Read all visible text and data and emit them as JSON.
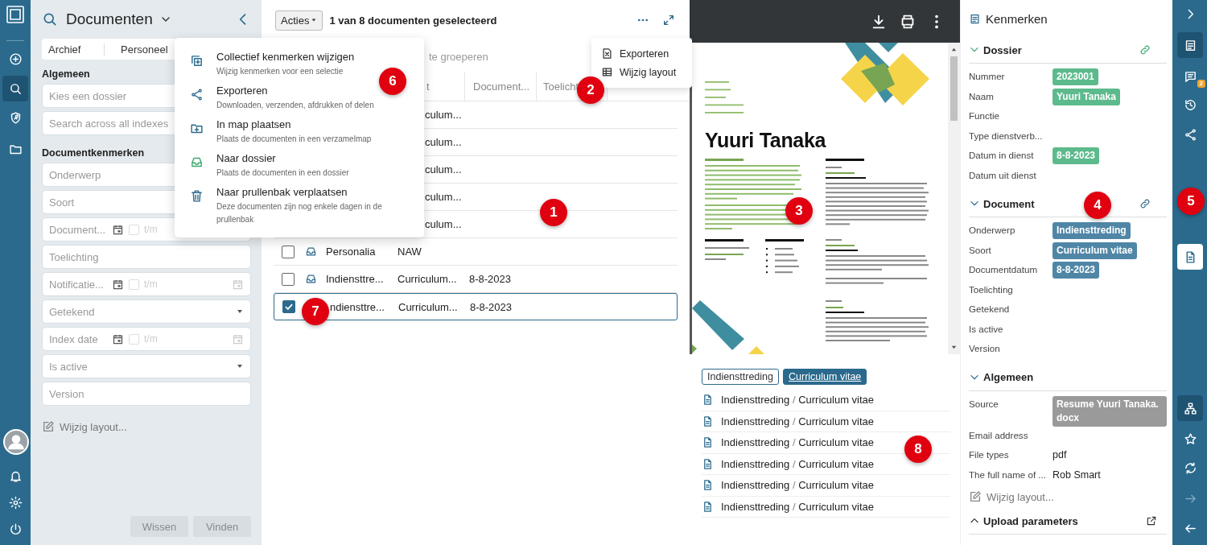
{
  "left_rail": {
    "top": [
      {
        "kind": "add",
        "selected": false
      },
      {
        "kind": "search",
        "selected": true
      },
      {
        "kind": "shield",
        "selected": false
      },
      {
        "kind": "folder",
        "selected": false
      }
    ],
    "bottom": [
      {
        "kind": "bell",
        "selected": false
      },
      {
        "kind": "gear",
        "selected": false
      },
      {
        "kind": "power",
        "selected": false
      }
    ]
  },
  "filter_panel": {
    "title": "Documenten",
    "tabs": [
      "Archief",
      "Personeel"
    ],
    "sections": [
      {
        "heading": "Algemeen",
        "fields": [
          {
            "kind": "text",
            "placeholder": "Kies een dossier"
          },
          {
            "kind": "text",
            "placeholder": "Search across all indexes"
          }
        ]
      },
      {
        "heading": "Documentkenmerken",
        "fields": [
          {
            "kind": "text",
            "placeholder": "Onderwerp"
          },
          {
            "kind": "text",
            "placeholder": "Soort"
          },
          {
            "kind": "daterange",
            "placeholder": "Document...",
            "to": "t/m",
            "checked": false
          },
          {
            "kind": "text",
            "placeholder": "Toelichting"
          },
          {
            "kind": "daterange",
            "placeholder": "Notificatie...",
            "to": "t/m",
            "checked": false,
            "end_calendar": true
          },
          {
            "kind": "select",
            "placeholder": "Getekend"
          },
          {
            "kind": "daterange",
            "placeholder": "Index date",
            "to": "t/m",
            "checked": false,
            "end_calendar": true
          },
          {
            "kind": "select",
            "placeholder": "Is active"
          },
          {
            "kind": "text",
            "placeholder": "Version"
          }
        ]
      }
    ],
    "edit_layout": "Wijzig layout...",
    "buttons": [
      {
        "label": "Wissen",
        "disabled": true
      },
      {
        "label": "Vinden",
        "disabled": true
      }
    ]
  },
  "toolbar": {
    "actions_button": "Acties",
    "selection_text": "1 van 8 documenten geselecteerd"
  },
  "group_hint": "te groeperen",
  "table": {
    "columns": [
      "t",
      "Document...",
      "Toelicht"
    ],
    "covered_rows": [
      {
        "type": "culum..."
      },
      {
        "type": "culum..."
      },
      {
        "type": "culum..."
      },
      {
        "type": "culum..."
      },
      {
        "type": "culum..."
      }
    ],
    "rows": [
      {
        "checked": false,
        "selected": false,
        "kind": "dossier",
        "name": "Personalia",
        "type": "NAW"
      },
      {
        "checked": false,
        "selected": false,
        "kind": "dossier",
        "name": "Indiensttre...",
        "type": "Curriculum...",
        "date": "8-8-2023"
      },
      {
        "checked": true,
        "selected": true,
        "name": "ndiensttre...",
        "type": "Curriculum...",
        "date": "8-8-2023"
      }
    ]
  },
  "actions_menu": {
    "items": [
      {
        "kind": "collective",
        "title": "Collectief kenmerken wijzigen",
        "description": "Wijzig kenmerken voor een selectie"
      },
      {
        "kind": "share",
        "title": "Exporteren",
        "description": "Downloaden, verzenden, afdrukken of delen"
      },
      {
        "kind": "folderplus",
        "title": "In map plaatsen",
        "description": "Plaats de documenten in een verzamelmap"
      },
      {
        "kind": "inbox",
        "title": "Naar dossier",
        "description": "Plaats de documenten in een dossier"
      },
      {
        "kind": "trash",
        "title": "Naar prullenbak verplaatsen",
        "description": "Deze documenten zijn nog enkele dagen in de prullenbak"
      }
    ]
  },
  "more_menu": {
    "items": [
      {
        "kind": "excel",
        "label": "Exporteren"
      },
      {
        "kind": "table",
        "label": "Wijzig layout"
      }
    ]
  },
  "preview": {
    "document": {
      "name": "Yuuri Tanaka"
    },
    "tags": [
      {
        "label": "Indiensttreding",
        "selected": false
      },
      {
        "label": "Curriculum vitae",
        "selected": true
      }
    ],
    "files": [
      {
        "subject": "Indiensttreding",
        "separator": "/",
        "type": "Curriculum vitae"
      },
      {
        "subject": "Indiensttreding",
        "separator": "/",
        "type": "Curriculum vitae"
      },
      {
        "subject": "Indiensttreding",
        "separator": "/",
        "type": "Curriculum vitae"
      },
      {
        "subject": "Indiensttreding",
        "separator": "/",
        "type": "Curriculum vitae"
      },
      {
        "subject": "Indiensttreding",
        "separator": "/",
        "type": "Curriculum vitae"
      },
      {
        "subject": "Indiensttreding",
        "separator": "/",
        "type": "Curriculum vitae"
      }
    ]
  },
  "properties_panel": {
    "title": "Kenmerken",
    "sections": [
      {
        "title": "Dossier",
        "expanded": true,
        "link": true,
        "rows": [
          {
            "label": "Nummer",
            "value": "2023001",
            "color": "#5dba8c"
          },
          {
            "label": "Naam",
            "value": "Yuuri Tanaka",
            "color": "#5dba8c"
          },
          {
            "label": "Functie"
          },
          {
            "label": "Type dienstverb..."
          },
          {
            "label": "Datum in dienst",
            "value": "8-8-2023",
            "color": "#5dba8c"
          },
          {
            "label": "Datum uit dienst"
          }
        ]
      },
      {
        "title": "Document",
        "expanded": true,
        "link": true,
        "rows": [
          {
            "label": "Onderwerp",
            "value": "Indiensttreding",
            "color": "#4f86a6"
          },
          {
            "label": "Soort",
            "value": "Curriculum vitae",
            "color": "#4f86a6"
          },
          {
            "label": "Documentdatum",
            "value": "8-8-2023",
            "color": "#4f86a6"
          },
          {
            "label": "Toelichting"
          },
          {
            "label": "Getekend"
          },
          {
            "label": "Is active"
          },
          {
            "label": "Version"
          }
        ]
      },
      {
        "title": "Algemeen",
        "expanded": true,
        "rows": [
          {
            "label": "Source",
            "value": "Resume Yuuri Tanaka.docx",
            "color": "#9a9a9a"
          },
          {
            "label": "Email address"
          },
          {
            "label": "File types",
            "value": "pdf"
          },
          {
            "label": "The full name of ...",
            "value": "Rob Smart"
          }
        ]
      }
    ],
    "edit_layout": "Wijzig layout...",
    "upload_section": {
      "title": "Upload parameters",
      "expanded": false
    }
  },
  "right_rail": {
    "items": [
      {
        "kind": "chevron",
        "selected": false
      },
      {
        "kind": "list",
        "selected": true
      },
      {
        "kind": "comment",
        "selected": false,
        "badge": "2"
      },
      {
        "kind": "history",
        "selected": false
      },
      {
        "kind": "share",
        "selected": false
      },
      {
        "kind": "document",
        "selected": false,
        "highlight": true
      },
      {
        "kind": "sitemap",
        "selected": true
      },
      {
        "kind": "star",
        "selected": false
      },
      {
        "kind": "sync",
        "selected": false
      },
      {
        "kind": "arrowright",
        "selected": false,
        "disabled": true
      },
      {
        "kind": "arrowleft",
        "selected": false
      }
    ]
  },
  "annotations": [
    "1",
    "2",
    "3",
    "4",
    "5",
    "6",
    "7",
    "8"
  ]
}
